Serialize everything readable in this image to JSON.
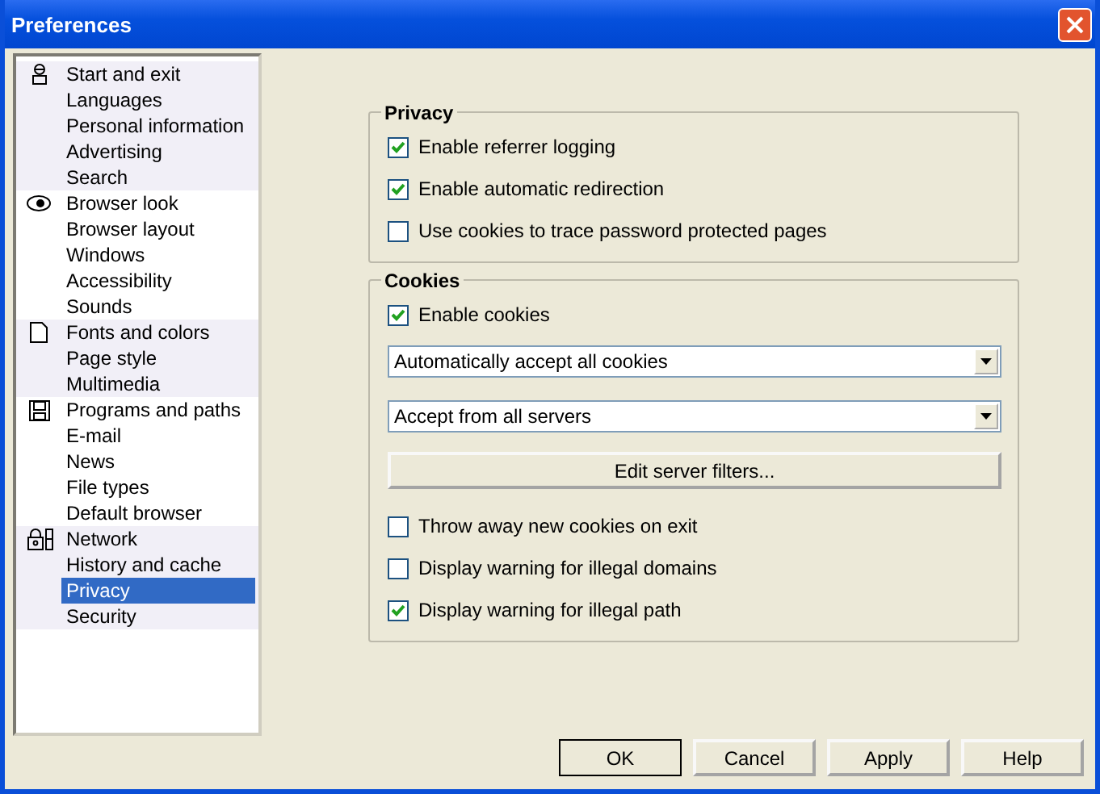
{
  "window": {
    "title": "Preferences"
  },
  "sidebar": {
    "groups": [
      {
        "items": [
          {
            "label": "Start and exit",
            "selected": false
          },
          {
            "label": "Languages",
            "selected": false
          },
          {
            "label": "Personal information",
            "selected": false
          },
          {
            "label": "Advertising",
            "selected": false
          },
          {
            "label": "Search",
            "selected": false
          }
        ]
      },
      {
        "items": [
          {
            "label": "Browser look",
            "selected": false
          },
          {
            "label": "Browser layout",
            "selected": false
          },
          {
            "label": "Windows",
            "selected": false
          },
          {
            "label": "Accessibility",
            "selected": false
          },
          {
            "label": "Sounds",
            "selected": false
          }
        ]
      },
      {
        "items": [
          {
            "label": "Fonts and colors",
            "selected": false
          },
          {
            "label": "Page style",
            "selected": false
          },
          {
            "label": "Multimedia",
            "selected": false
          }
        ]
      },
      {
        "items": [
          {
            "label": "Programs and paths",
            "selected": false
          },
          {
            "label": "E-mail",
            "selected": false
          },
          {
            "label": "News",
            "selected": false
          },
          {
            "label": "File types",
            "selected": false
          },
          {
            "label": "Default browser",
            "selected": false
          }
        ]
      },
      {
        "items": [
          {
            "label": "Network",
            "selected": false
          },
          {
            "label": "History and cache",
            "selected": false
          },
          {
            "label": "Privacy",
            "selected": true
          },
          {
            "label": "Security",
            "selected": false
          }
        ]
      }
    ]
  },
  "sections": [
    {
      "title": "Privacy",
      "controls": [
        {
          "kind": "checkbox",
          "label": "Enable referrer logging",
          "checked": true
        },
        {
          "kind": "checkbox",
          "label": "Enable automatic redirection",
          "checked": true
        },
        {
          "kind": "checkbox",
          "label": "Use cookies to trace password protected pages",
          "checked": false
        }
      ]
    },
    {
      "title": "Cookies",
      "controls": [
        {
          "kind": "checkbox",
          "label": "Enable cookies",
          "checked": true
        },
        {
          "kind": "dropdown",
          "label": "Automatically accept all cookies"
        },
        {
          "kind": "dropdown",
          "label": "Accept from all servers"
        },
        {
          "kind": "button",
          "label": "Edit server filters..."
        },
        {
          "kind": "checkbox",
          "label": "Throw away new cookies on exit",
          "checked": false
        },
        {
          "kind": "checkbox",
          "label": "Display warning for illegal domains",
          "checked": false
        },
        {
          "kind": "checkbox",
          "label": "Display warning for illegal path",
          "checked": true
        }
      ]
    }
  ],
  "buttons": [
    "OK",
    "Cancel",
    "Apply",
    "Help"
  ]
}
